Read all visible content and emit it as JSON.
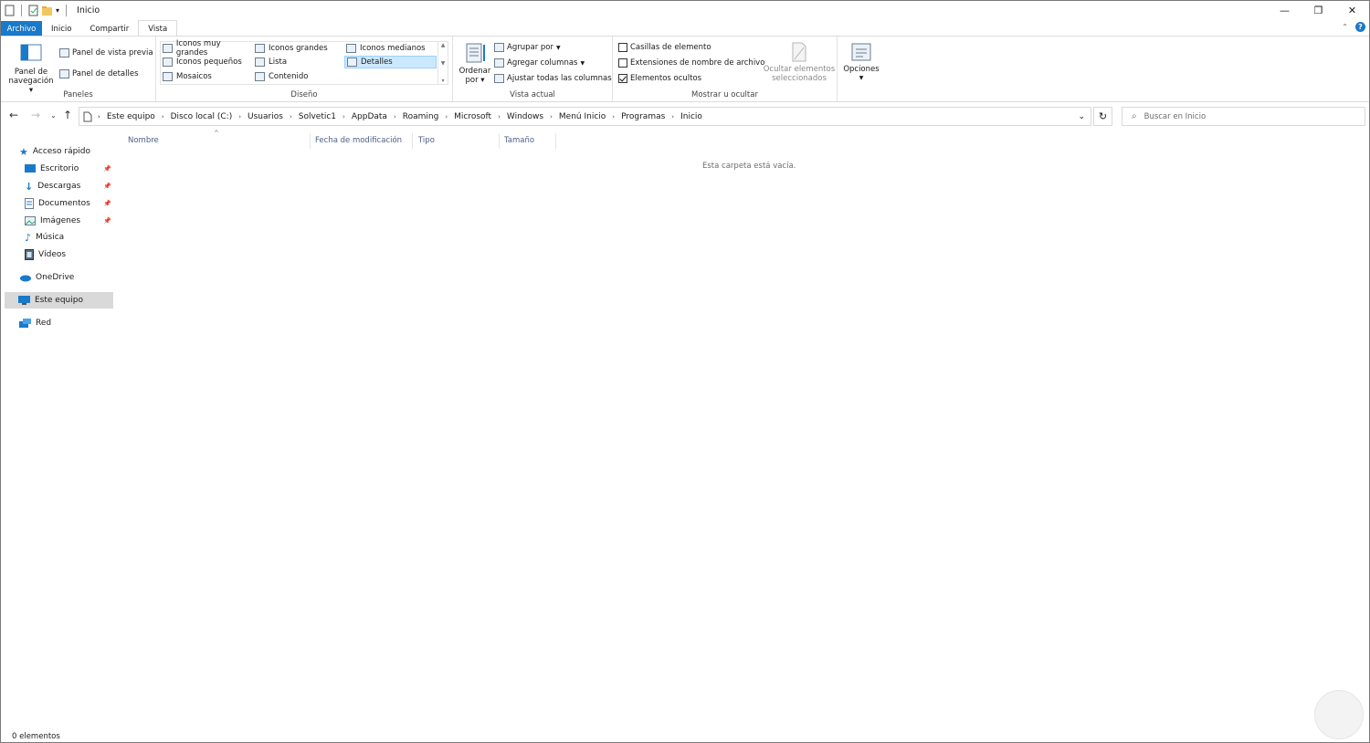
{
  "window": {
    "title": "Inicio"
  },
  "ribbon_tabs": [
    "Archivo",
    "Inicio",
    "Compartir",
    "Vista"
  ],
  "ribbon": {
    "paneles": {
      "nav_pane_line1": "Panel de",
      "nav_pane_line2": "navegación",
      "preview_pane": "Panel de vista previa",
      "details_pane": "Panel de detalles",
      "group_label": "Paneles"
    },
    "diseno": {
      "items": [
        "Iconos muy grandes",
        "Iconos grandes",
        "Iconos medianos",
        "Iconos pequeños",
        "Lista",
        "Detalles",
        "Mosaicos",
        "Contenido"
      ],
      "selected": "Detalles",
      "group_label": "Diseño"
    },
    "vista_actual": {
      "sort_line1": "Ordenar",
      "sort_line2": "por",
      "group_by": "Agrupar por",
      "add_columns": "Agregar columnas",
      "fit_columns": "Ajustar todas las columnas",
      "group_label": "Vista actual"
    },
    "mostrar": {
      "item_checkboxes": "Casillas de elemento",
      "file_extensions": "Extensiones de nombre de archivo",
      "hidden_items": "Elementos ocultos",
      "item_checkboxes_checked": false,
      "file_extensions_checked": false,
      "hidden_items_checked": true,
      "hide_selected_line1": "Ocultar elementos",
      "hide_selected_line2": "seleccionados",
      "group_label": "Mostrar u ocultar"
    },
    "options": "Opciones"
  },
  "breadcrumb": [
    "Este equipo",
    "Disco local (C:)",
    "Usuarios",
    "Solvetic1",
    "AppData",
    "Roaming",
    "Microsoft",
    "Windows",
    "Menú Inicio",
    "Programas",
    "Inicio"
  ],
  "search": {
    "placeholder": "Buscar en Inicio"
  },
  "nav_pane": {
    "quick_access": "Acceso rápido",
    "quick_items": [
      "Escritorio",
      "Descargas",
      "Documentos",
      "Imágenes",
      "Música",
      "Vídeos"
    ],
    "onedrive": "OneDrive",
    "this_pc": "Este equipo",
    "network": "Red"
  },
  "columns": [
    "Nombre",
    "Fecha de modificación",
    "Tipo",
    "Tamaño"
  ],
  "empty_message": "Esta carpeta está vacía.",
  "status": "0 elementos",
  "colors": {
    "accent": "#1979ca",
    "selection": "#cce8ff",
    "nav_selected": "#d9d9d9"
  }
}
